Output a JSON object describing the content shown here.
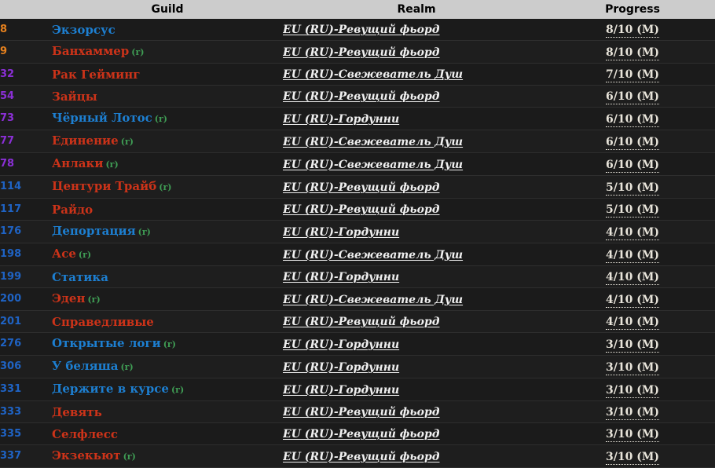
{
  "table": {
    "columns": [
      {
        "key": "rank",
        "label": ""
      },
      {
        "key": "guild",
        "label": "Guild"
      },
      {
        "key": "realm",
        "label": "Realm"
      },
      {
        "key": "progress",
        "label": "Progress"
      }
    ],
    "colors": {
      "header_background": "#cccccc",
      "header_text": "#000000",
      "row_background": "#1b1b1b",
      "row_background_alt": "#1e1e1e",
      "row_divider": "#2e2e2e",
      "rank_orange": "#e8821e",
      "rank_purple": "#8b2fd6",
      "rank_blue": "#1f63c4",
      "guild_red": "#cc3319",
      "guild_blue": "#1d7fd1",
      "realm_link": "#f0f0f0",
      "progress_text": "#e8e4da",
      "recruiting_flag": "#3f9c54"
    },
    "rows": [
      {
        "rank": "8",
        "rank_color": "#e8821e",
        "guild": "Экзорсус",
        "guild_color": "#1d7fd1",
        "flag": "",
        "realm": "EU (RU)-Ревущий фьорд",
        "progress": "8/10 (M)"
      },
      {
        "rank": "9",
        "rank_color": "#e8821e",
        "guild": "Банхаммер",
        "guild_color": "#cc3319",
        "flag": "(r)",
        "realm": "EU (RU)-Ревущий фьорд",
        "progress": "8/10 (M)"
      },
      {
        "rank": "32",
        "rank_color": "#8b2fd6",
        "guild": "Рак Гейминг",
        "guild_color": "#cc3319",
        "flag": "",
        "realm": "EU (RU)-Свежеватель Душ",
        "progress": "7/10 (M)"
      },
      {
        "rank": "54",
        "rank_color": "#8b2fd6",
        "guild": "Зайцы",
        "guild_color": "#cc3319",
        "flag": "",
        "realm": "EU (RU)-Ревущий фьорд",
        "progress": "6/10 (M)"
      },
      {
        "rank": "73",
        "rank_color": "#8b2fd6",
        "guild": "Чёрный Лотос",
        "guild_color": "#1d7fd1",
        "flag": "(r)",
        "realm": "EU (RU)-Гордунни",
        "progress": "6/10 (M)"
      },
      {
        "rank": "77",
        "rank_color": "#8b2fd6",
        "guild": "Единение",
        "guild_color": "#cc3319",
        "flag": "(r)",
        "realm": "EU (RU)-Свежеватель Душ",
        "progress": "6/10 (M)"
      },
      {
        "rank": "78",
        "rank_color": "#8b2fd6",
        "guild": "Анлаки",
        "guild_color": "#cc3319",
        "flag": "(r)",
        "realm": "EU (RU)-Свежеватель Душ",
        "progress": "6/10 (M)"
      },
      {
        "rank": "114",
        "rank_color": "#1f63c4",
        "guild": "Центури Трайб",
        "guild_color": "#cc3319",
        "flag": "(r)",
        "realm": "EU (RU)-Ревущий фьорд",
        "progress": "5/10 (M)"
      },
      {
        "rank": "117",
        "rank_color": "#1f63c4",
        "guild": "Райдо",
        "guild_color": "#cc3319",
        "flag": "",
        "realm": "EU (RU)-Ревущий фьорд",
        "progress": "5/10 (M)"
      },
      {
        "rank": "176",
        "rank_color": "#1f63c4",
        "guild": "Депортация",
        "guild_color": "#1d7fd1",
        "flag": "(r)",
        "realm": "EU (RU)-Гордунни",
        "progress": "4/10 (M)"
      },
      {
        "rank": "198",
        "rank_color": "#1f63c4",
        "guild": "Асе",
        "guild_color": "#cc3319",
        "flag": "(r)",
        "realm": "EU (RU)-Свежеватель Душ",
        "progress": "4/10 (M)"
      },
      {
        "rank": "199",
        "rank_color": "#1f63c4",
        "guild": "Статика",
        "guild_color": "#1d7fd1",
        "flag": "",
        "realm": "EU (RU)-Гордунни",
        "progress": "4/10 (M)"
      },
      {
        "rank": "200",
        "rank_color": "#1f63c4",
        "guild": "Эден",
        "guild_color": "#cc3319",
        "flag": "(r)",
        "realm": "EU (RU)-Свежеватель Душ",
        "progress": "4/10 (M)"
      },
      {
        "rank": "201",
        "rank_color": "#1f63c4",
        "guild": "Справедливые",
        "guild_color": "#cc3319",
        "flag": "",
        "realm": "EU (RU)-Ревущий фьорд",
        "progress": "4/10 (M)"
      },
      {
        "rank": "276",
        "rank_color": "#1f63c4",
        "guild": "Открытые логи",
        "guild_color": "#1d7fd1",
        "flag": "(r)",
        "realm": "EU (RU)-Гордунни",
        "progress": "3/10 (M)"
      },
      {
        "rank": "306",
        "rank_color": "#1f63c4",
        "guild": "У беляша",
        "guild_color": "#1d7fd1",
        "flag": "(r)",
        "realm": "EU (RU)-Гордунни",
        "progress": "3/10 (M)"
      },
      {
        "rank": "331",
        "rank_color": "#1f63c4",
        "guild": "Держите в курсе",
        "guild_color": "#1d7fd1",
        "flag": "(r)",
        "realm": "EU (RU)-Гордунни",
        "progress": "3/10 (M)"
      },
      {
        "rank": "333",
        "rank_color": "#1f63c4",
        "guild": "Девять",
        "guild_color": "#cc3319",
        "flag": "",
        "realm": "EU (RU)-Ревущий фьорд",
        "progress": "3/10 (M)"
      },
      {
        "rank": "335",
        "rank_color": "#1f63c4",
        "guild": "Селфлесс",
        "guild_color": "#cc3319",
        "flag": "",
        "realm": "EU (RU)-Ревущий фьорд",
        "progress": "3/10 (M)"
      },
      {
        "rank": "337",
        "rank_color": "#1f63c4",
        "guild": "Экзекьют",
        "guild_color": "#cc3319",
        "flag": "(r)",
        "realm": "EU (RU)-Ревущий фьорд",
        "progress": "3/10 (M)"
      }
    ]
  }
}
